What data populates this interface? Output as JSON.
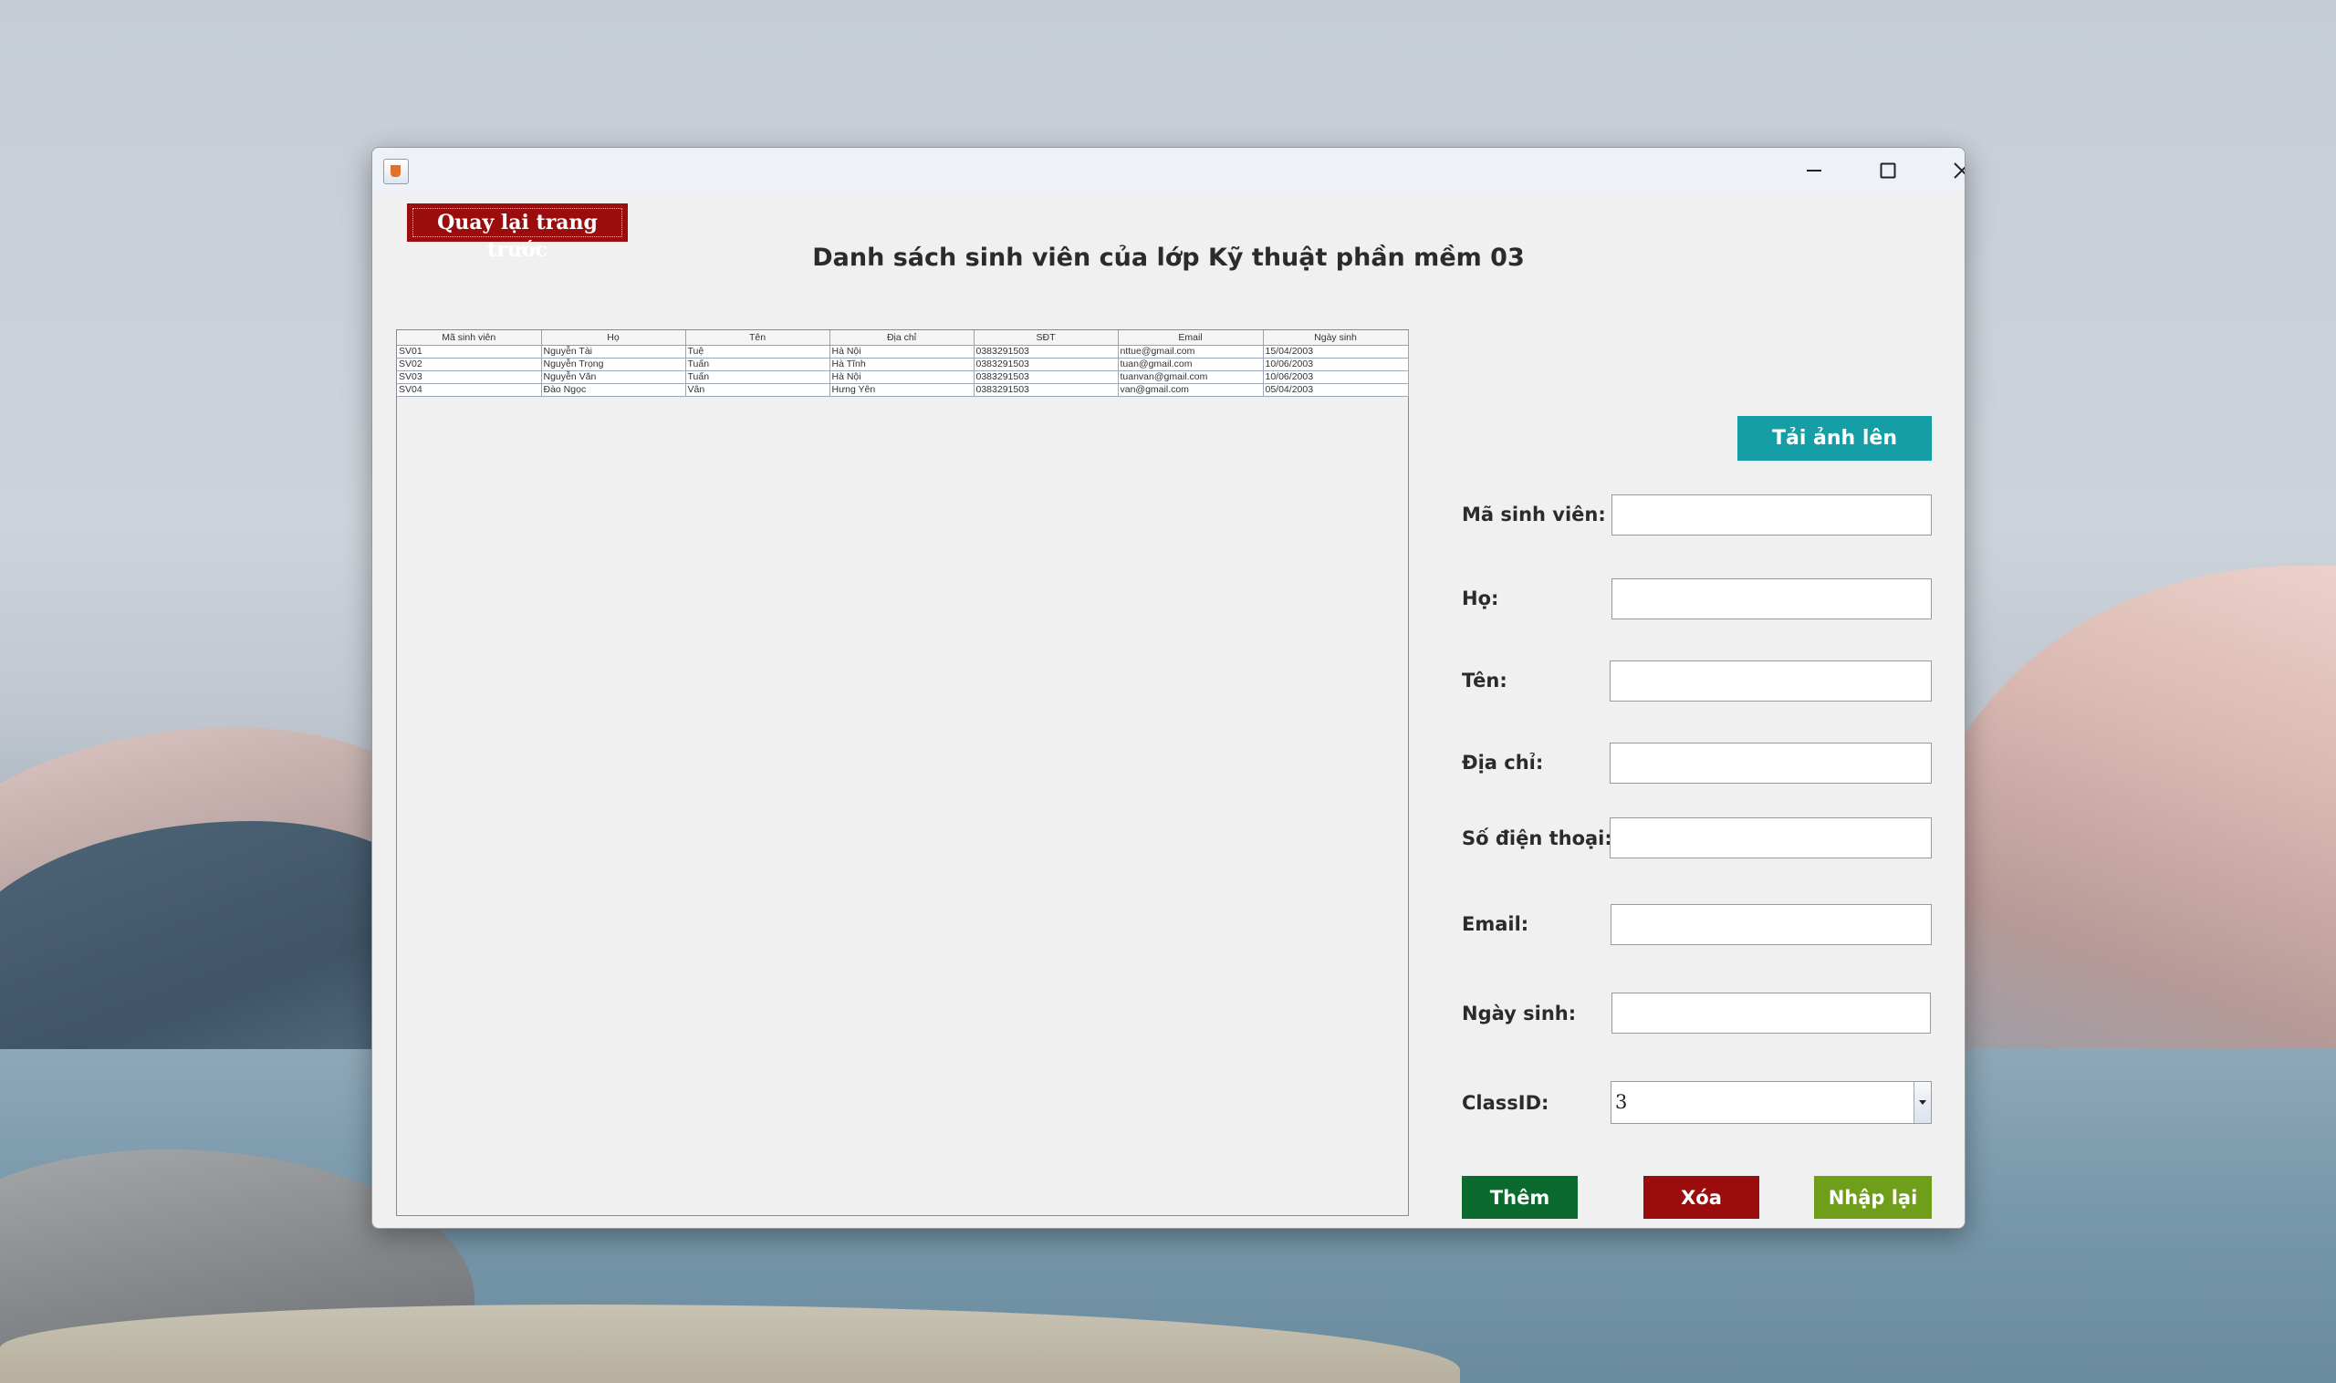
{
  "window": {
    "minimize_label": "minimize",
    "maximize_label": "maximize",
    "close_label": "close"
  },
  "header": {
    "back_label": "Quay lại trang trước",
    "title": "Danh sách sinh viên của lớp Kỹ thuật phần mềm 03"
  },
  "table": {
    "columns": [
      "Mã sinh viên",
      "Họ",
      "Tên",
      "Địa chỉ",
      "SĐT",
      "Email",
      "Ngày sinh"
    ],
    "rows": [
      [
        "SV01",
        "Nguyễn Tài",
        "Tuệ",
        "Hà Nội",
        "0383291503",
        "nttue@gmail.com",
        "15/04/2003"
      ],
      [
        "SV02",
        "Nguyễn Trọng",
        "Tuấn",
        "Hà Tĩnh",
        "0383291503",
        "tuan@gmail.com",
        "10/06/2003"
      ],
      [
        "SV03",
        "Nguyễn Văn",
        "Tuấn",
        "Hà Nội",
        "0383291503",
        "tuanvan@gmail.com",
        "10/06/2003"
      ],
      [
        "SV04",
        "Đào Ngọc",
        "Vân",
        "Hưng Yên",
        "0383291503",
        "van@gmail.com",
        "05/04/2003"
      ]
    ]
  },
  "form": {
    "upload_label": "Tải ảnh lên",
    "student_id_label": "Mã sinh viên:",
    "student_id_value": "",
    "last_name_label": "Họ:",
    "last_name_value": "",
    "first_name_label": "Tên:",
    "first_name_value": "",
    "address_label": "Địa chỉ:",
    "address_value": "",
    "phone_label": "Số điện thoại:",
    "phone_value": "",
    "email_label": "Email:",
    "email_value": "",
    "birthdate_label": "Ngày sinh:",
    "birthdate_value": "",
    "class_id_label": "ClassID:",
    "class_id_value": "3"
  },
  "actions": {
    "add_label": "Thêm",
    "delete_label": "Xóa",
    "reset_label": "Nhập lại"
  },
  "colors": {
    "back_button": "#9b0d0d",
    "upload_button": "#169ea6",
    "add_button": "#0b6b2f",
    "delete_button": "#9b0d0d",
    "reset_button": "#6e9e1a"
  }
}
